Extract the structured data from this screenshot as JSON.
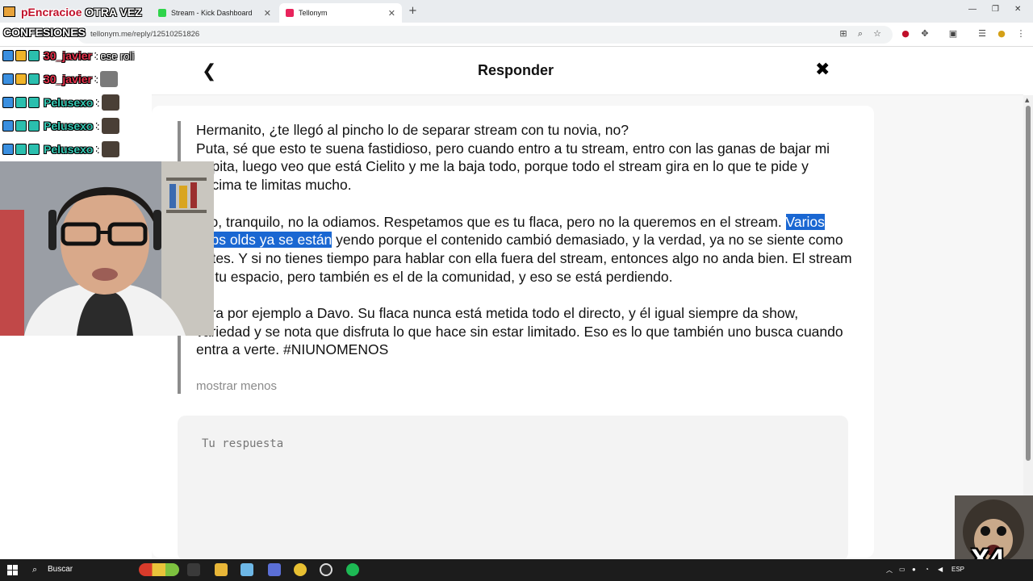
{
  "browser": {
    "tabs": [
      {
        "title": "p..."
      },
      {
        "title": "Stream - Kick Dashboard"
      },
      {
        "title": "Tellonym"
      }
    ],
    "url": "tellonym.me/reply/12510251826"
  },
  "page": {
    "title": "Responder",
    "message": {
      "paragraphs": [
        "Hermanito, ¿te llegó al pincho lo de separar stream con tu novia, no?\nPuta, sé que esto te suena fastidioso, pero cuando entro a tu stream, entro con las ganas de bajar mi pepita, luego veo que está Cielito y me la baja todo, porque todo el stream gira en lo que te pide y encima te limitas mucho.",
        "__P2__",
        "Mira por ejemplo a Davo. Su flaca nunca está metida todo el directo, y él igual siempre da show, variedad y se nota que disfruta lo que hace sin estar limitado. Eso es lo que también uno busca cuando entra a verte.  #NIUNOMENOS"
      ],
      "p2_before": "Ojo, tranquilo, no la odiamos. Respetamos que es tu flaca, pero no la queremos en el stream. ",
      "p2_highlight": "Varios subs olds ya se están",
      "p2_after": " yendo porque el contenido cambió demasiado, y la verdad, ya no se siente como antes. Y si no tienes tiempo para hablar con ella fuera del stream, entonces algo no anda bien. El stream es tu espacio, pero también es el de la comunidad, y eso se está perdiendo."
    },
    "show_less": "mostrar menos",
    "answer_placeholder": "Tu respuesta"
  },
  "overlay": {
    "title_red": "pEncracioe",
    "title_white": " OTRA VEZ",
    "subtitle": "CONFESIONES",
    "chat": [
      {
        "user": "30_javier",
        "color": "#e8334d",
        "message": "ese roli"
      },
      {
        "user": "30_javier",
        "color": "#e8334d",
        "message": ""
      },
      {
        "user": "Pelusexo",
        "color": "#36c9b4",
        "message": ""
      },
      {
        "user": "Pelusexo",
        "color": "#36c9b4",
        "message": ""
      },
      {
        "user": "Pelusexo",
        "color": "#36c9b4",
        "message": ""
      }
    ],
    "multiplier": "X4"
  },
  "taskbar": {
    "search": "Buscar",
    "lang": "ESP"
  }
}
